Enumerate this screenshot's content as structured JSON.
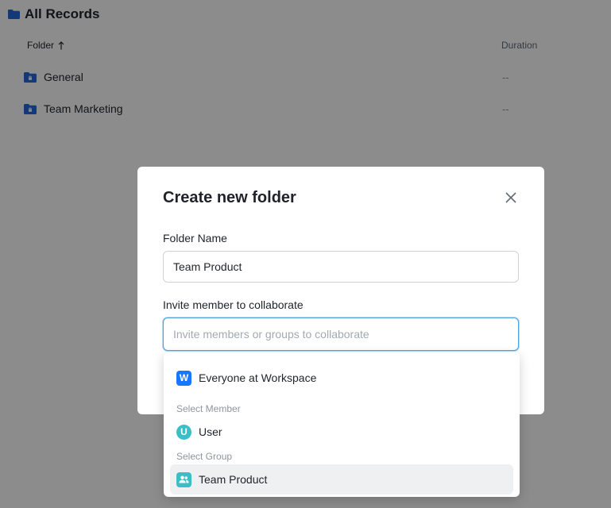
{
  "page": {
    "title": "All Records",
    "columns": {
      "folder": "Folder",
      "duration": "Duration"
    },
    "rows": [
      {
        "name": "General",
        "duration": "--"
      },
      {
        "name": "Team Marketing",
        "duration": "--"
      }
    ]
  },
  "modal": {
    "title": "Create new folder",
    "folder_name_label": "Folder Name",
    "folder_name_value": "Team Product",
    "invite_label": "Invite member to collaborate",
    "invite_placeholder": "Invite members or groups to collaborate",
    "invite_value": ""
  },
  "dropdown": {
    "workspace": {
      "initial": "W",
      "label": "Everyone at Workspace"
    },
    "member_section": "Select Member",
    "member": {
      "initial": "U",
      "label": "User"
    },
    "group_section": "Select Group",
    "group": {
      "label": "Team Product"
    }
  },
  "colors": {
    "accent": "#1677ff",
    "folder_icon": "#2468d8",
    "teal": "#3bbec6",
    "focus_border": "#4aa3df"
  }
}
